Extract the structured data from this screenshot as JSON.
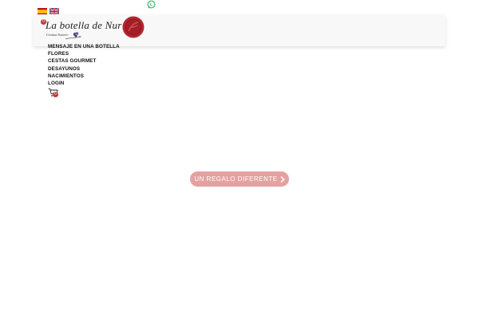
{
  "languages": [
    {
      "code": "es",
      "icon": "spain-flag-icon"
    },
    {
      "code": "en",
      "icon": "uk-flag-icon"
    }
  ],
  "contact": {
    "icon": "whatsapp-icon"
  },
  "logo": {
    "title": "La botella de Nur",
    "subtitle": "Cristina Navarro"
  },
  "header": {
    "cart_count_top": "0"
  },
  "nav": {
    "items": [
      "MENSAJE EN UNA BOTELLA",
      "FLORES",
      "CESTAS GOURMET",
      "DESAYUNOS",
      "NACIMIENTOS",
      "LOGIN"
    ]
  },
  "cart": {
    "icon": "cart-icon",
    "count": "0"
  },
  "hero": {
    "cta_label": "UN REGALO DIFERENTE"
  },
  "colors": {
    "accent": "#c8343b",
    "cta_bg": "#e5a1a1",
    "seal": "#b5262e"
  }
}
